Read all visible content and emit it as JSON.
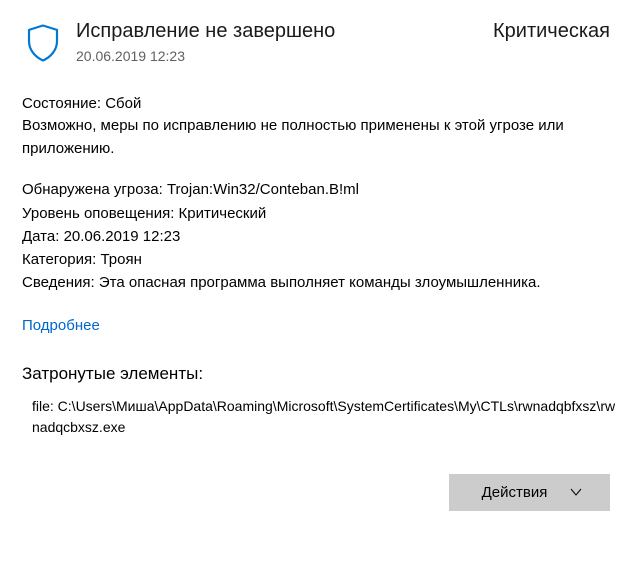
{
  "header": {
    "title": "Исправление не завершено",
    "severity": "Критическая",
    "timestamp": "20.06.2019 12:23"
  },
  "status": {
    "label": "Состояние:",
    "value": "Сбой",
    "description": "Возможно, меры по исправлению не полностью применены к этой угрозе или приложению."
  },
  "details": {
    "threat_label": "Обнаружена угроза:",
    "threat_value": "Trojan:Win32/Conteban.B!ml",
    "alert_level_label": "Уровень оповещения:",
    "alert_level_value": "Критический",
    "date_label": "Дата:",
    "date_value": "20.06.2019 12:23",
    "category_label": "Категория:",
    "category_value": "Троян",
    "info_label": "Сведения:",
    "info_value": "Эта опасная программа выполняет команды злоумышленника."
  },
  "learn_more": "Подробнее",
  "affected": {
    "title": "Затронутые элементы:",
    "file": "file: C:\\Users\\Миша\\AppData\\Roaming\\Microsoft\\SystemCertificates\\My\\CTLs\\rwnadqbfxsz\\rwnadqcbxsz.exe"
  },
  "actions_button": "Действия"
}
